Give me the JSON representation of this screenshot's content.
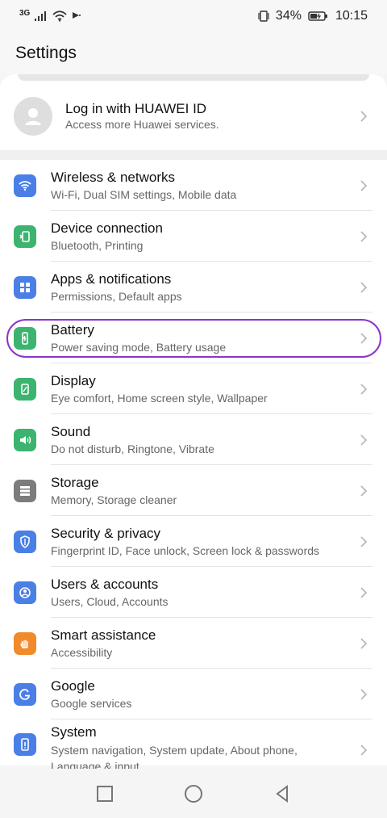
{
  "status": {
    "network": "3G",
    "battery": "34%",
    "time": "10:15"
  },
  "header": {
    "title": "Settings"
  },
  "account": {
    "title": "Log in with HUAWEI ID",
    "subtitle": "Access more Huawei services."
  },
  "settings": [
    {
      "title": "Wireless & networks",
      "subtitle": "Wi-Fi, Dual SIM settings, Mobile data"
    },
    {
      "title": "Device connection",
      "subtitle": "Bluetooth, Printing"
    },
    {
      "title": "Apps & notifications",
      "subtitle": "Permissions, Default apps"
    },
    {
      "title": "Battery",
      "subtitle": "Power saving mode, Battery usage"
    },
    {
      "title": "Display",
      "subtitle": "Eye comfort, Home screen style, Wallpaper"
    },
    {
      "title": "Sound",
      "subtitle": "Do not disturb, Ringtone, Vibrate"
    },
    {
      "title": "Storage",
      "subtitle": "Memory, Storage cleaner"
    },
    {
      "title": "Security & privacy",
      "subtitle": "Fingerprint ID, Face unlock, Screen lock & passwords"
    },
    {
      "title": "Users & accounts",
      "subtitle": "Users, Cloud, Accounts"
    },
    {
      "title": "Smart assistance",
      "subtitle": "Accessibility"
    },
    {
      "title": "Google",
      "subtitle": "Google services"
    },
    {
      "title": "System",
      "subtitle": "System navigation, System update, About phone, Language & input"
    }
  ],
  "icons": {
    "wireless": "#4b7fe6",
    "device": "#3cb46f",
    "apps": "#4a7fe6",
    "battery": "#3cb46f",
    "display": "#3cb46f",
    "sound": "#3cb46f",
    "storage": "#7c7c7c",
    "security": "#4a7fe6",
    "users": "#4a7fe6",
    "smart": "#f08a2a",
    "google": "#4a7fe6",
    "system": "#4a7fe6",
    "highlight": "#8b35c8"
  }
}
